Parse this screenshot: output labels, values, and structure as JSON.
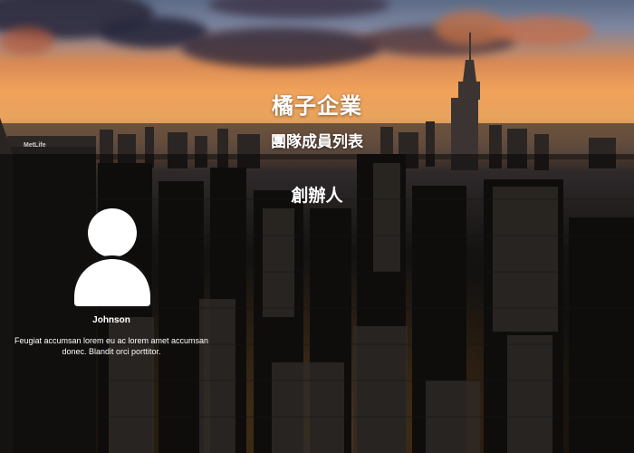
{
  "header": {
    "brand": "橘子企業",
    "subtitle": "團隊成員列表"
  },
  "section": {
    "title": "創辦人"
  },
  "members": [
    {
      "name": "Johnson",
      "description": "Feugiat accumsan lorem eu ac lorem amet accumsan donec. Blandit orci porttitor.",
      "avatar_icon": "user-silhouette-icon"
    }
  ],
  "background": {
    "building_sign": "MetLife"
  }
}
